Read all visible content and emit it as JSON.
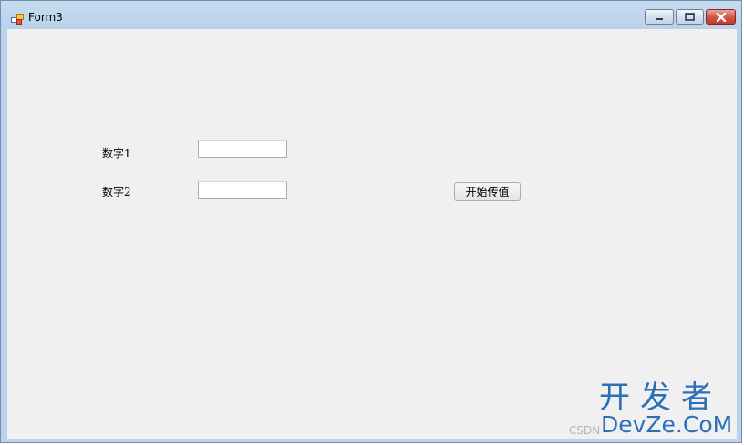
{
  "window": {
    "title": "Form3",
    "controls": {
      "minimize": "minimize-icon",
      "maximize": "maximize-icon",
      "close": "close-icon"
    }
  },
  "form": {
    "label1": "数字1",
    "label2": "数字2",
    "input1_value": "",
    "input2_value": "",
    "button_label": "开始传值"
  },
  "watermark": {
    "line1": "开发者",
    "line2": "DevZe.CoM",
    "csdn": "CSDN"
  },
  "colors": {
    "titlebar": "#b9d1ea",
    "client": "#f0f0f0",
    "close_button": "#c03c2c",
    "watermark": "#2c6fb7"
  }
}
